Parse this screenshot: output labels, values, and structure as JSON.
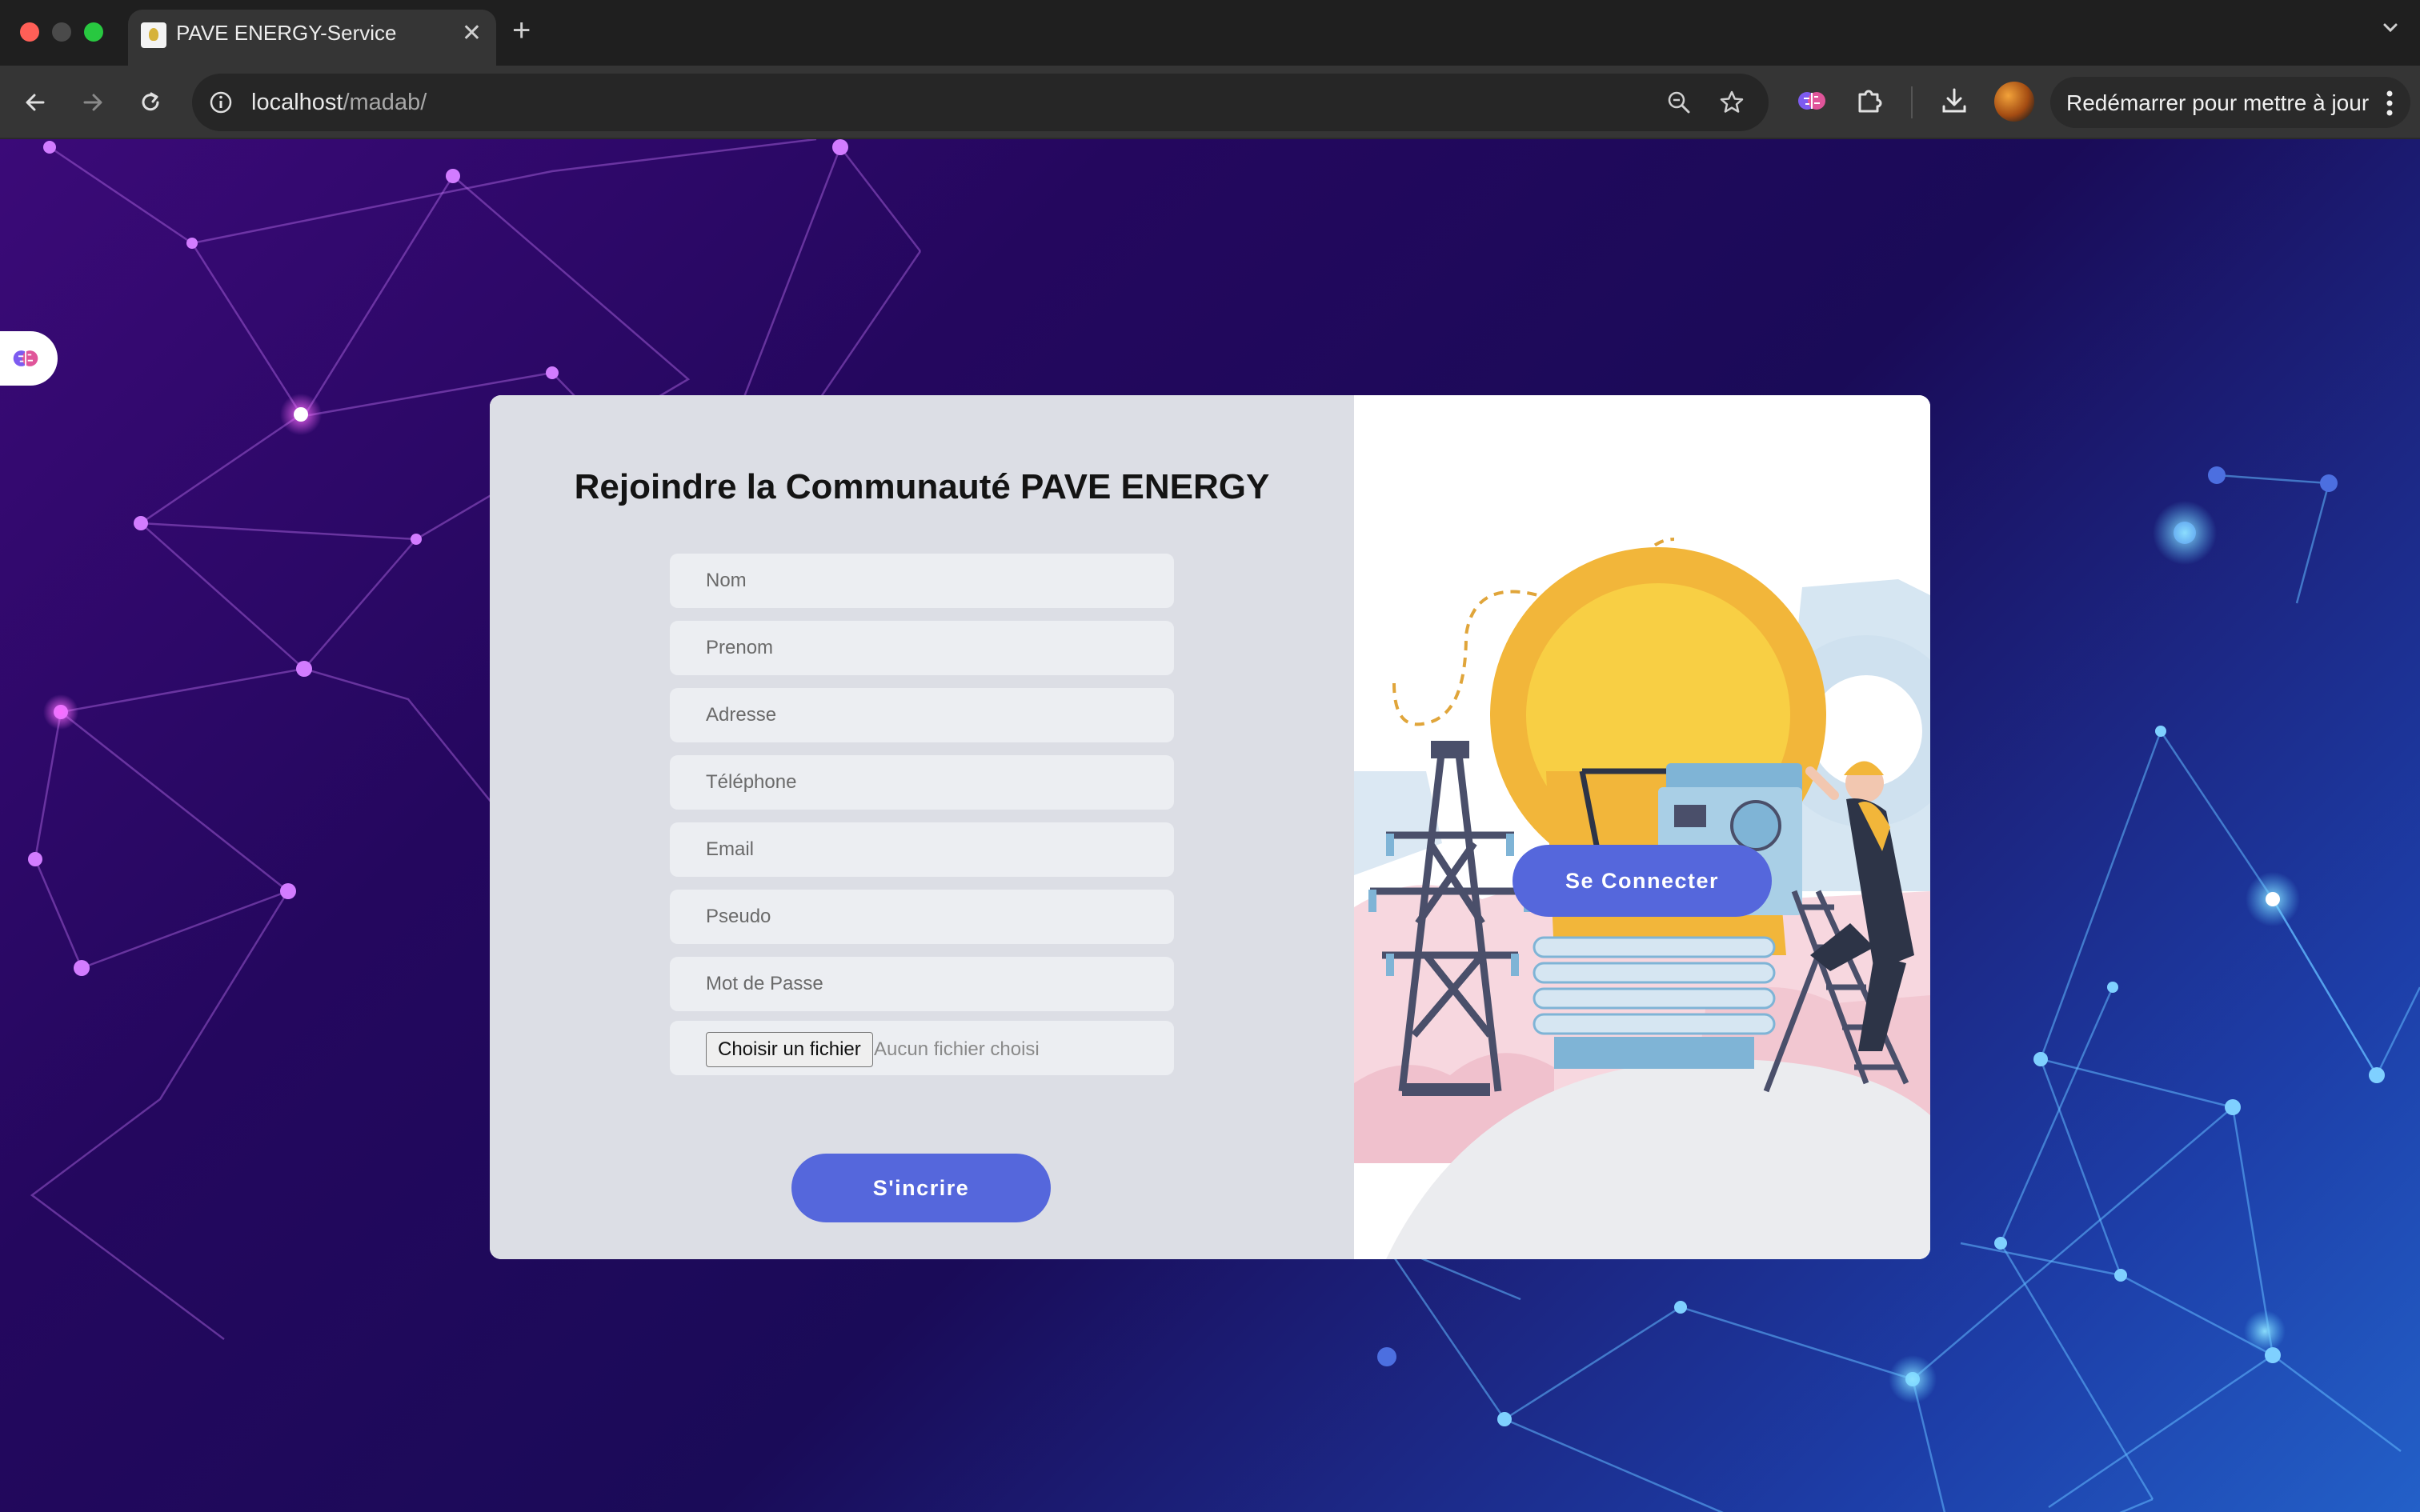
{
  "browser": {
    "tab_title": "PAVE ENERGY-Service",
    "url_host": "localhost",
    "url_path": "/madab/",
    "update_label": "Redémarrer pour mettre à jour"
  },
  "form": {
    "title": "Rejoindre la Communauté PAVE ENERGY",
    "fields": [
      {
        "placeholder": "Nom"
      },
      {
        "placeholder": "Prenom"
      },
      {
        "placeholder": "Adresse"
      },
      {
        "placeholder": "Téléphone"
      },
      {
        "placeholder": "Email"
      },
      {
        "placeholder": "Pseudo"
      },
      {
        "placeholder": "Mot de Passe"
      }
    ],
    "file_button_label": "Choisir un fichier",
    "file_status": "Aucun fichier choisi",
    "submit_label": "S'incrire"
  },
  "side_panel": {
    "connect_label": "Se Connecter"
  },
  "colors": {
    "accent": "#5567dc",
    "form_bg": "#dcdee5",
    "field_bg": "#eceef2"
  },
  "icons": [
    "back-arrow-icon",
    "forward-arrow-icon",
    "reload-icon",
    "info-icon",
    "zoom-icon",
    "bookmark-star-icon",
    "brain-extension-icon",
    "puzzle-extension-icon",
    "download-icon",
    "kebab-menu-icon",
    "chevron-down-icon",
    "close-icon",
    "plus-icon"
  ]
}
